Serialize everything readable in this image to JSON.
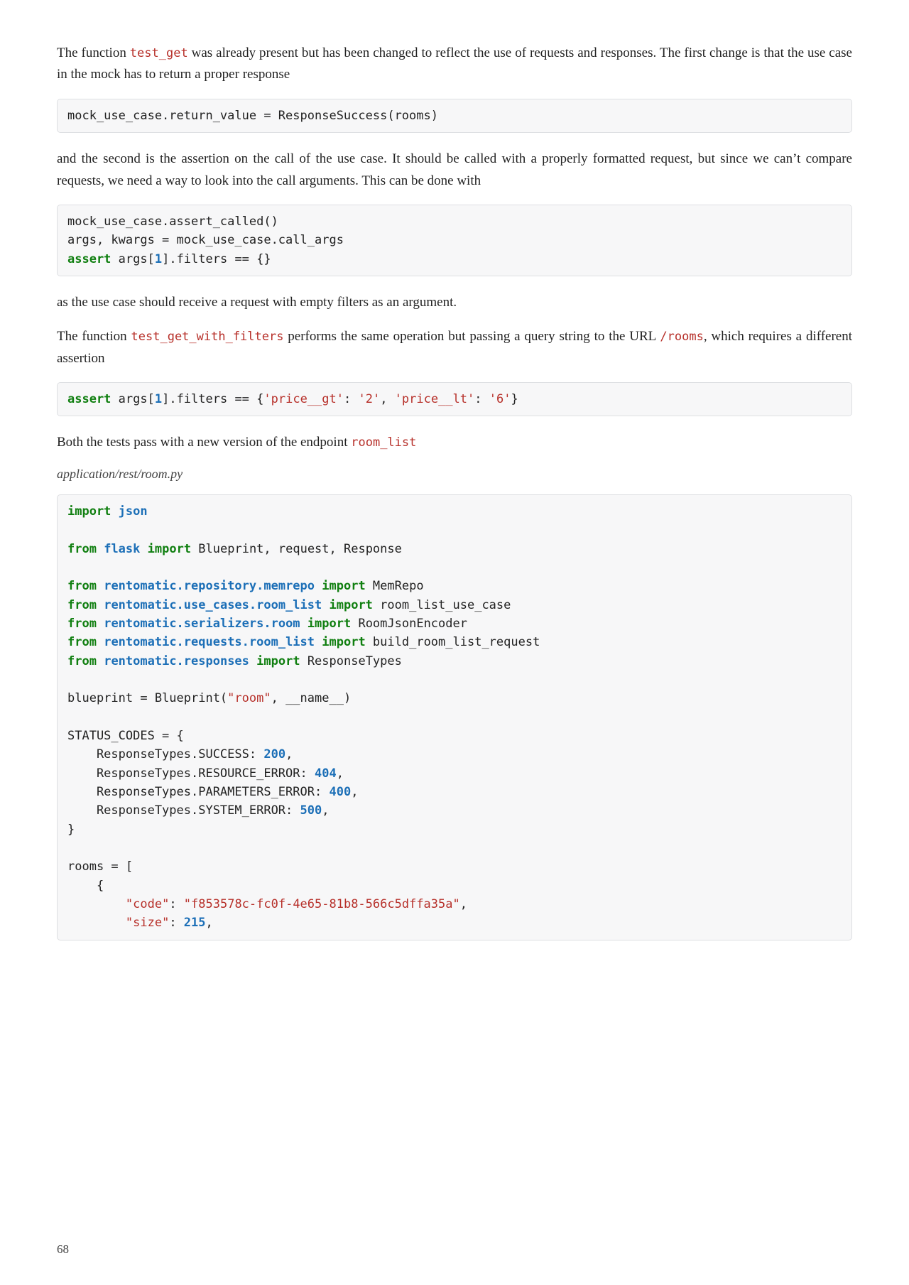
{
  "para1_a": "The function ",
  "para1_code1": "test_get",
  "para1_b": " was already present but has been changed to reflect the use of requests and responses. The first change is that the use case in the mock has to return a proper response",
  "code1": "mock_use_case.return_value = ResponseSuccess(rooms)",
  "para2": "and the second is the assertion on the call of the use case. It should be called with a properly formatted request, but since we can’t compare requests, we need a way to look into the call arguments. This can be done with",
  "code2": {
    "l1": "mock_use_case.assert_called()",
    "l2": "args, kwargs = mock_use_case.call_args",
    "l3_kw": "assert",
    "l3_a": " args[",
    "l3_num": "1",
    "l3_b": "].filters == {}"
  },
  "para3": "as the use case should receive a request with empty filters as an argument.",
  "para4_a": "The function ",
  "para4_code1": "test_get_with_filters",
  "para4_b": " performs the same operation but passing a query string to the URL ",
  "para4_code2": "/rooms",
  "para4_c": ", which requires a different assertion",
  "code3": {
    "kw": "assert",
    "a": " args[",
    "num": "1",
    "b": "].filters == {",
    "s1": "'price__gt'",
    "c": ": ",
    "s2": "'2'",
    "d": ", ",
    "s3": "'price__lt'",
    "e": ": ",
    "s4": "'6'",
    "f": "}"
  },
  "para5_a": "Both the tests pass with a new version of the endpoint ",
  "para5_code1": "room_list",
  "filename": "application/rest/room.py",
  "code4": {
    "l1_kw": "import",
    "l1_mod": "json",
    "l3_from": "from",
    "l3_mod": "flask",
    "l3_import": "import",
    "l3_rest": " Blueprint, request, Response",
    "l5_from": "from",
    "l5_mod": "rentomatic.repository.memrepo",
    "l5_import": "import",
    "l5_rest": " MemRepo",
    "l6_from": "from",
    "l6_mod": "rentomatic.use_cases.room_list",
    "l6_import": "import",
    "l6_rest": " room_list_use_case",
    "l7_from": "from",
    "l7_mod": "rentomatic.serializers.room",
    "l7_import": "import",
    "l7_rest": " RoomJsonEncoder",
    "l8_from": "from",
    "l8_mod": "rentomatic.requests.room_list",
    "l8_import": "import",
    "l8_rest": " build_room_list_request",
    "l9_from": "from",
    "l9_mod": "rentomatic.responses",
    "l9_import": "import",
    "l9_rest": " ResponseTypes",
    "l11_a": "blueprint = Blueprint(",
    "l11_s": "\"room\"",
    "l11_b": ", __name__)",
    "l13": "STATUS_CODES = {",
    "l14_a": "    ResponseTypes.SUCCESS: ",
    "l14_n": "200",
    "l14_b": ",",
    "l15_a": "    ResponseTypes.RESOURCE_ERROR: ",
    "l15_n": "404",
    "l15_b": ",",
    "l16_a": "    ResponseTypes.PARAMETERS_ERROR: ",
    "l16_n": "400",
    "l16_b": ",",
    "l17_a": "    ResponseTypes.SYSTEM_ERROR: ",
    "l17_n": "500",
    "l17_b": ",",
    "l18": "}",
    "l20": "rooms = [",
    "l21": "    {",
    "l22_a": "        ",
    "l22_k": "\"code\"",
    "l22_b": ": ",
    "l22_v": "\"f853578c-fc0f-4e65-81b8-566c5dffa35a\"",
    "l22_c": ",",
    "l23_a": "        ",
    "l23_k": "\"size\"",
    "l23_b": ": ",
    "l23_v": "215",
    "l23_c": ","
  },
  "pagenum": "68"
}
